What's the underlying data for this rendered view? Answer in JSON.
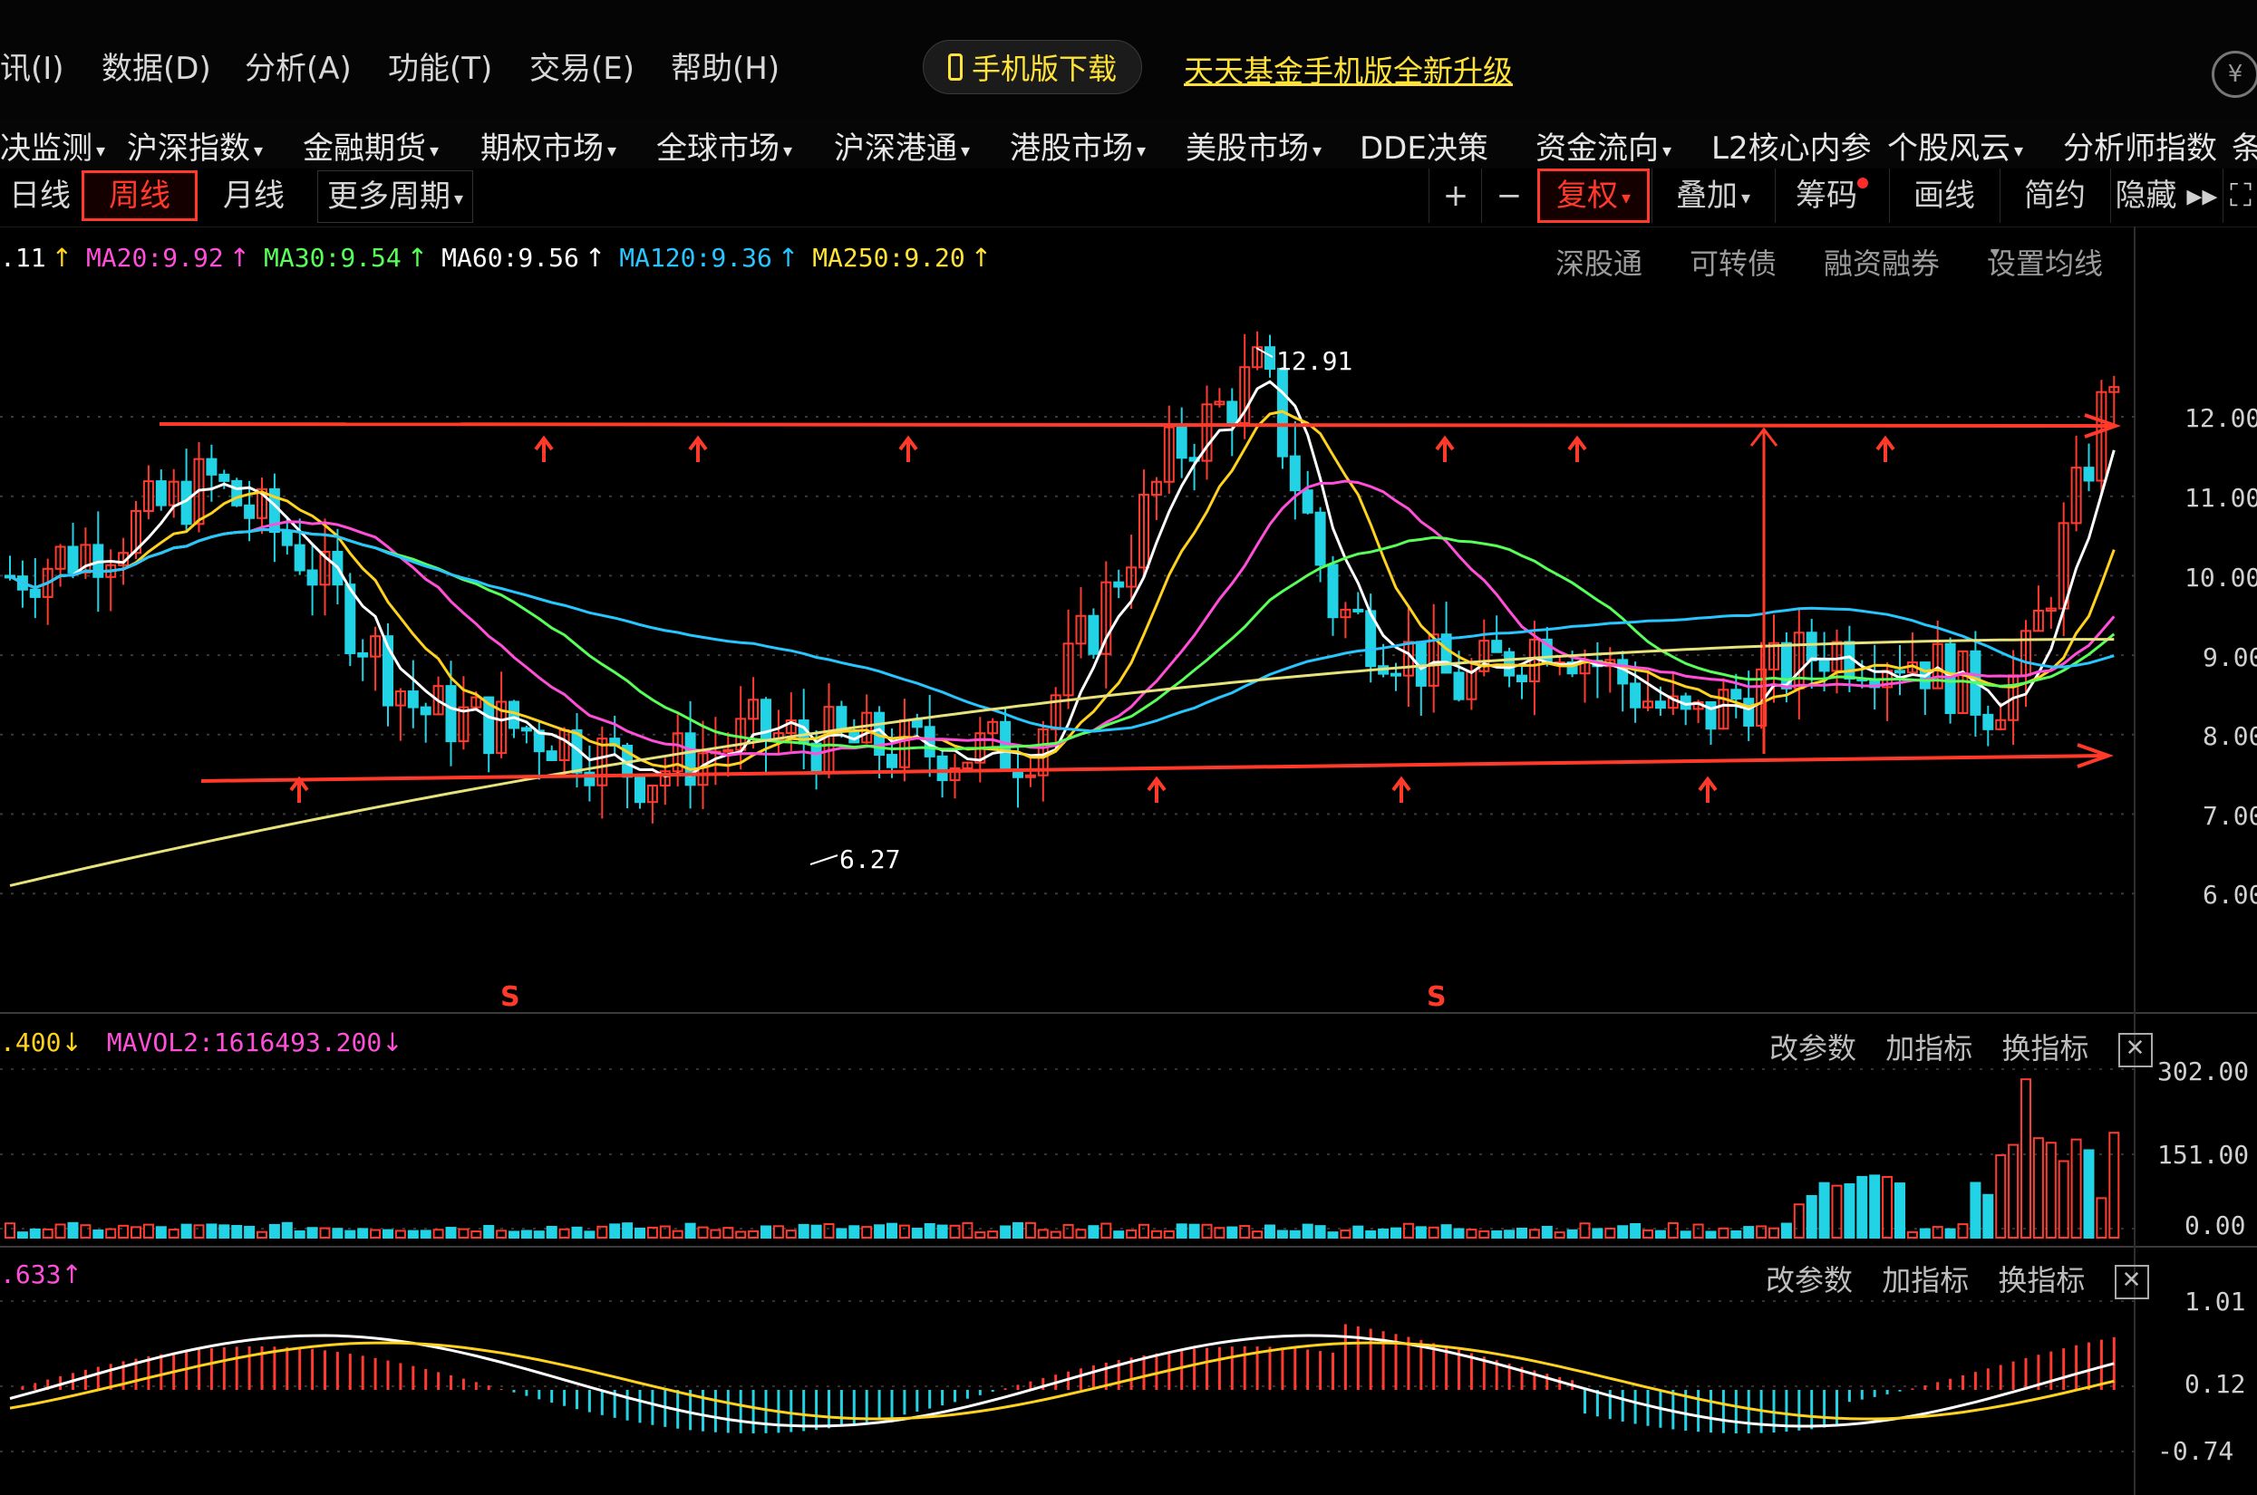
{
  "menu": {
    "items": [
      "讯(I)",
      "数据(D)",
      "分析(A)",
      "功能(T)",
      "交易(E)",
      "帮助(H)"
    ],
    "download_button": "手机版下载",
    "promo_link": "天天基金手机版全新升级",
    "yen_icon": "¥"
  },
  "market_nav": {
    "items": [
      "决监测",
      "沪深指数",
      "金融期货",
      "期权市场",
      "全球市场",
      "沪深港通",
      "港股市场",
      "美股市场",
      "DDE决策",
      "资金流向",
      "L2核心内参",
      "个股风云",
      "分析师指数",
      "条"
    ]
  },
  "periods": {
    "items": [
      "日线",
      "周线",
      "月线",
      "更多周期"
    ],
    "active": "周线"
  },
  "toolbar": {
    "plus": "+",
    "minus": "−",
    "fuquan": "复权",
    "overlay": "叠加",
    "chips": "筹码",
    "draw": "画线",
    "simple": "简约",
    "hide": "隐藏 ▸▸",
    "expand": "⛶"
  },
  "ma_legend": {
    "ma_first": ".11",
    "ma20": "MA20:9.92",
    "ma30": "MA30:9.54",
    "ma60": "MA60:9.56",
    "ma120": "MA120:9.36",
    "ma250": "MA250:9.20",
    "arrow": "↑"
  },
  "ma_options": [
    "深股通",
    "可转债",
    "融资融券",
    "设置均线"
  ],
  "panel_tools": {
    "params": "改参数",
    "add": "加指标",
    "swap": "换指标",
    "close": "✕"
  },
  "volume_legend": {
    "mavol1": ".400",
    "mavol2": "MAVOL2:1616493.200",
    "arrow_down": "↓"
  },
  "macd_legend": {
    "value": ".633",
    "arrow": "↑"
  },
  "price_axis": [
    "12.00",
    "11.00",
    "10.00",
    "9.00",
    "8.00",
    "7.00",
    "6.00"
  ],
  "volume_axis": [
    "302.00",
    "151.00",
    "0.00"
  ],
  "macd_axis": [
    "1.01",
    "0.12",
    "-0.74"
  ],
  "annotations": {
    "high": "12.91",
    "low": "6.27",
    "s_marker": "S"
  },
  "colors": {
    "up": "#ff3b2f",
    "down": "#22d3e6",
    "ma_white": "#ffffff",
    "ma_yellow": "#ffd21f",
    "ma_pink": "#ff4fd8",
    "ma_green": "#58ff58",
    "ma_cyan": "#27c6ff",
    "ma_250": "#e8e27a",
    "accent": "#ff3a2a",
    "promo": "#ffe23a"
  },
  "chart_data": {
    "type": "candlestick",
    "period": "周线",
    "price_range": [
      6.0,
      12.91
    ],
    "high": 12.91,
    "low": 6.27,
    "moving_averages": {
      "MA20": 9.92,
      "MA30": 9.54,
      "MA60": 9.56,
      "MA120": 9.36,
      "MA250": 9.2
    },
    "volume_range": [
      0,
      302
    ],
    "macd_range": [
      -0.74,
      1.01
    ]
  }
}
